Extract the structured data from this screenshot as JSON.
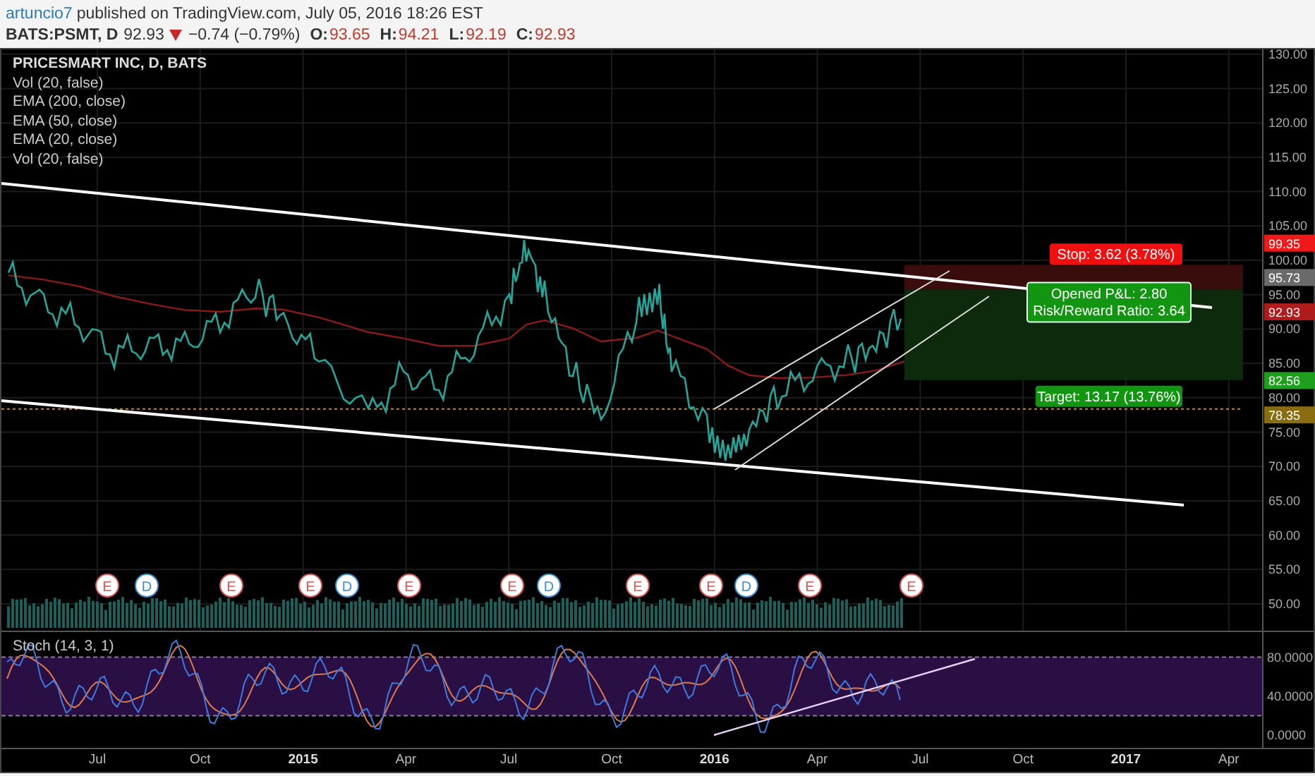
{
  "header": {
    "author": "artuncio7",
    "published": "published on TradingView.com, July 05, 2016 18:26 EST"
  },
  "quote": {
    "symbol": "BATS:PSMT, D",
    "last": "92.93",
    "falling": true,
    "change": "−0.74 (−0.79%)",
    "ohlc": [
      {
        "label": "O:",
        "value": "93.65"
      },
      {
        "label": "H:",
        "value": "94.21"
      },
      {
        "label": "L:",
        "value": "92.19"
      },
      {
        "label": "C:",
        "value": "92.93"
      }
    ]
  },
  "legend": {
    "title": "PRICESMART INC, D, BATS",
    "studies": [
      "Vol (20, false)",
      "EMA (200, close)",
      "EMA (50, close)",
      "EMA (20, close)",
      "Vol (20, false)"
    ]
  },
  "price_pane": {
    "price_axis": [
      "130.00",
      "125.00",
      "120.00",
      "115.00",
      "110.00",
      "105.00",
      "100.00",
      "95.00",
      "90.00",
      "85.00",
      "80.00",
      "75.00",
      "70.00",
      "65.00",
      "60.00",
      "55.00",
      "50.00"
    ],
    "events": [
      {
        "kind": "earnings",
        "label": "E"
      },
      {
        "kind": "dividend",
        "label": "D"
      },
      {
        "kind": "earnings",
        "label": "E"
      },
      {
        "kind": "earnings",
        "label": "E"
      },
      {
        "kind": "dividend",
        "label": "D"
      },
      {
        "kind": "earnings",
        "label": "E"
      },
      {
        "kind": "earnings",
        "label": "E"
      },
      {
        "kind": "dividend",
        "label": "D"
      },
      {
        "kind": "earnings",
        "label": "E"
      },
      {
        "kind": "earnings",
        "label": "E"
      },
      {
        "kind": "dividend",
        "label": "D"
      },
      {
        "kind": "earnings",
        "label": "E"
      },
      {
        "kind": "earnings",
        "label": "E"
      }
    ],
    "price_labels": [
      {
        "text": "99.35",
        "color": "#f01818"
      },
      {
        "text": "95.73",
        "color": "#6a6a6a"
      },
      {
        "text": "92.93",
        "color": "#b01c1c"
      },
      {
        "text": "82.56",
        "color": "#1ea01e"
      },
      {
        "text": "78.35",
        "color": "#8a6d10"
      }
    ],
    "position": {
      "stop": "Stop: 3.62 (3.78%)",
      "info": [
        "Opened P&L: 2.80",
        "Risk/Reward Ratio: 3.64"
      ],
      "target": "Target: 13.17 (13.76%)"
    }
  },
  "stoch_pane": {
    "title": "Stoch (14, 3, 1)",
    "axis_labels": [
      "80.0000",
      "40.0000",
      "0.0000"
    ]
  },
  "time_axis": [
    {
      "label": "Jul",
      "kind": "month"
    },
    {
      "label": "Oct",
      "kind": "month"
    },
    {
      "label": "2015",
      "kind": "year"
    },
    {
      "label": "Apr",
      "kind": "month"
    },
    {
      "label": "Jul",
      "kind": "month"
    },
    {
      "label": "Oct",
      "kind": "month"
    },
    {
      "label": "2016",
      "kind": "year"
    },
    {
      "label": "Apr",
      "kind": "month"
    },
    {
      "label": "Jul",
      "kind": "month"
    },
    {
      "label": "Oct",
      "kind": "month"
    },
    {
      "label": "2017",
      "kind": "year"
    },
    {
      "label": "Apr",
      "kind": "month"
    }
  ]
}
